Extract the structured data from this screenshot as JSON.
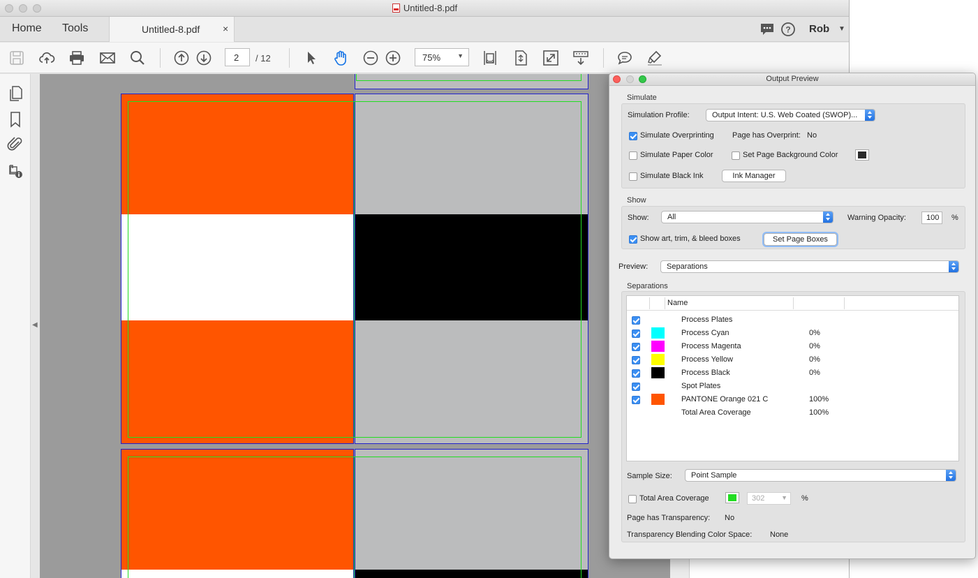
{
  "window": {
    "title": "Untitled-8.pdf"
  },
  "tabs": {
    "home": "Home",
    "tools": "Tools",
    "document": "Untitled-8.pdf",
    "close": "×"
  },
  "header_right": {
    "user": "Rob",
    "icons": [
      "comment-bubble-icon",
      "help-icon",
      "chevron-down-icon"
    ]
  },
  "toolbar": {
    "page_current": "2",
    "page_total": "/ 12",
    "zoom": "75%",
    "icons": [
      "save-icon",
      "cloud-upload-icon",
      "print-icon",
      "email-icon",
      "search-icon",
      "page-up-icon",
      "page-down-icon",
      "select-arrow-icon",
      "hand-icon",
      "zoom-out-icon",
      "zoom-in-icon",
      "fit-width-icon",
      "fit-page-icon",
      "full-screen-icon",
      "scrolling-mode-icon",
      "comment-icon",
      "highlight-icon"
    ]
  },
  "left_panel": {
    "icons": [
      "pages-icon",
      "bookmark-icon",
      "attachment-icon",
      "document-info-icon"
    ]
  },
  "colors": {
    "orange": "#ff5500",
    "gray_fill": "#bbbcbd",
    "black": "#000000",
    "trim_green": "#22dd22",
    "bleed_blue": "#2222cc",
    "canvas": "#9b9b9b"
  },
  "dialog": {
    "title": "Output Preview",
    "simulate": {
      "section": "Simulate",
      "profile_label": "Simulation Profile:",
      "profile_value": "Output Intent: U.S. Web Coated (SWOP)...",
      "overprint_label": "Simulate Overprinting",
      "overprint_checked": true,
      "page_overprint_label": "Page has Overprint:",
      "page_overprint_value": "No",
      "paper_color_label": "Simulate Paper Color",
      "page_bg_label": "Set Page Background Color",
      "black_ink_label": "Simulate Black Ink",
      "ink_manager_button": "Ink Manager"
    },
    "show": {
      "section": "Show",
      "show_label": "Show:",
      "show_value": "All",
      "warning_label": "Warning Opacity:",
      "warning_value": "100",
      "percent": "%",
      "boxes_label": "Show art, trim, & bleed boxes",
      "boxes_checked": true,
      "set_boxes_button": "Set Page Boxes"
    },
    "preview": {
      "label": "Preview:",
      "value": "Separations"
    },
    "separations": {
      "section": "Separations",
      "name_header": "Name",
      "rows": [
        {
          "name": "Process Plates",
          "percent": "",
          "color": ""
        },
        {
          "name": "Process Cyan",
          "percent": "0%",
          "color": "#00ffff"
        },
        {
          "name": "Process Magenta",
          "percent": "0%",
          "color": "#ff00ff"
        },
        {
          "name": "Process Yellow",
          "percent": "0%",
          "color": "#ffff00"
        },
        {
          "name": "Process Black",
          "percent": "0%",
          "color": "#000000"
        },
        {
          "name": "Spot Plates",
          "percent": "",
          "color": ""
        },
        {
          "name": "PANTONE Orange 021 C",
          "percent": "100%",
          "color": "#ff5500"
        },
        {
          "name": "Total Area Coverage",
          "percent": "100%",
          "color": ""
        }
      ]
    },
    "sample": {
      "label": "Sample Size:",
      "value": "Point Sample"
    },
    "tac": {
      "label": "Total Area Coverage",
      "value": "302",
      "percent": "%"
    },
    "transparency": {
      "label": "Page has Transparency:",
      "value": "No"
    },
    "blending": {
      "label": "Transparency Blending Color Space:",
      "value": "None"
    }
  }
}
